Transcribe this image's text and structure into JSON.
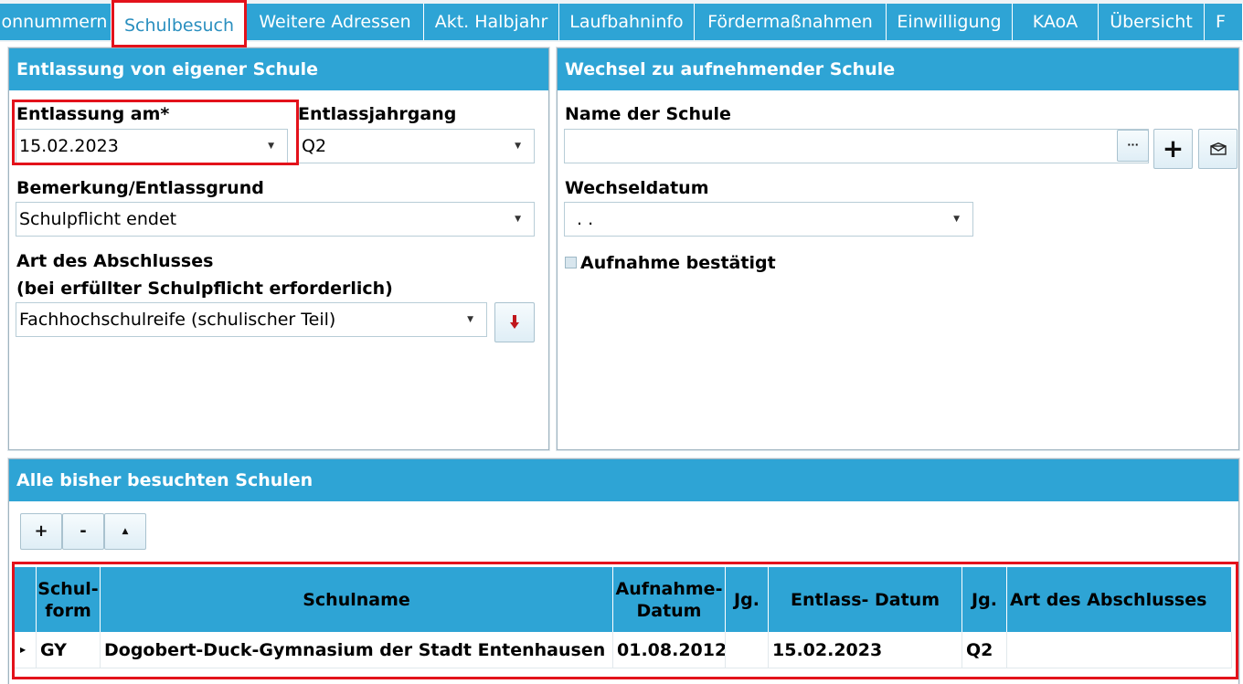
{
  "tabs": [
    {
      "label": "onnummern"
    },
    {
      "label": "Schulbesuch"
    },
    {
      "label": "Weitere Adressen"
    },
    {
      "label": "Akt. Halbjahr"
    },
    {
      "label": "Laufbahninfo"
    },
    {
      "label": "Fördermaßnahmen"
    },
    {
      "label": "Einwilligung"
    },
    {
      "label": "KAoA"
    },
    {
      "label": "Übersicht"
    },
    {
      "label": "F"
    }
  ],
  "entlassung": {
    "title": "Entlassung von eigener Schule",
    "date_label": "Entlassung am*",
    "date_value": "15.02.2023",
    "jahrgang_label": "Entlassjahrgang",
    "jahrgang_value": "Q2",
    "bemerkung_label": "Bemerkung/Entlassgrund",
    "bemerkung_value": "Schulpflicht endet",
    "abschluss_label_1": "Art des Abschlusses",
    "abschluss_label_2": "(bei erfüllter Schulpflicht erforderlich)",
    "abschluss_value": "Fachhochschulreife (schulischer Teil)"
  },
  "wechsel": {
    "title": "Wechsel zu aufnehmender Schule",
    "name_label": "Name der Schule",
    "name_value": "",
    "ellipsis": "···",
    "add_symbol": "+",
    "date_label": "Wechseldatum",
    "date_value": ".  .",
    "confirm_label": "Aufnahme bestätigt"
  },
  "schulen": {
    "title": "Alle bisher besuchten Schulen",
    "toolbar": {
      "add": "+",
      "remove": "-",
      "up": "▲"
    },
    "columns": {
      "schulform": "Schul-\nform",
      "schulname": "Schulname",
      "aufnahme": "Aufnahme-\nDatum",
      "jg1": "Jg.",
      "entlass": "Entlass- Datum",
      "jg2": "Jg.",
      "abschluss": "Art des Abschlusses"
    },
    "rows": [
      {
        "schulform": "GY",
        "schulname": "Dogobert-Duck-Gymnasium der Stadt Entenhausen",
        "aufnahme": "01.08.2012",
        "jg1": "",
        "entlass": "15.02.2023",
        "jg2": "Q2",
        "abschluss": ""
      }
    ]
  },
  "icons": {
    "dropdown": "chevron-down-icon",
    "move_down": "arrow-down-icon",
    "mail": "envelope-icon"
  },
  "colors": {
    "accent": "#2ea4d5",
    "highlight": "#e3121b",
    "active_tab_text": "#2a8fbf"
  }
}
